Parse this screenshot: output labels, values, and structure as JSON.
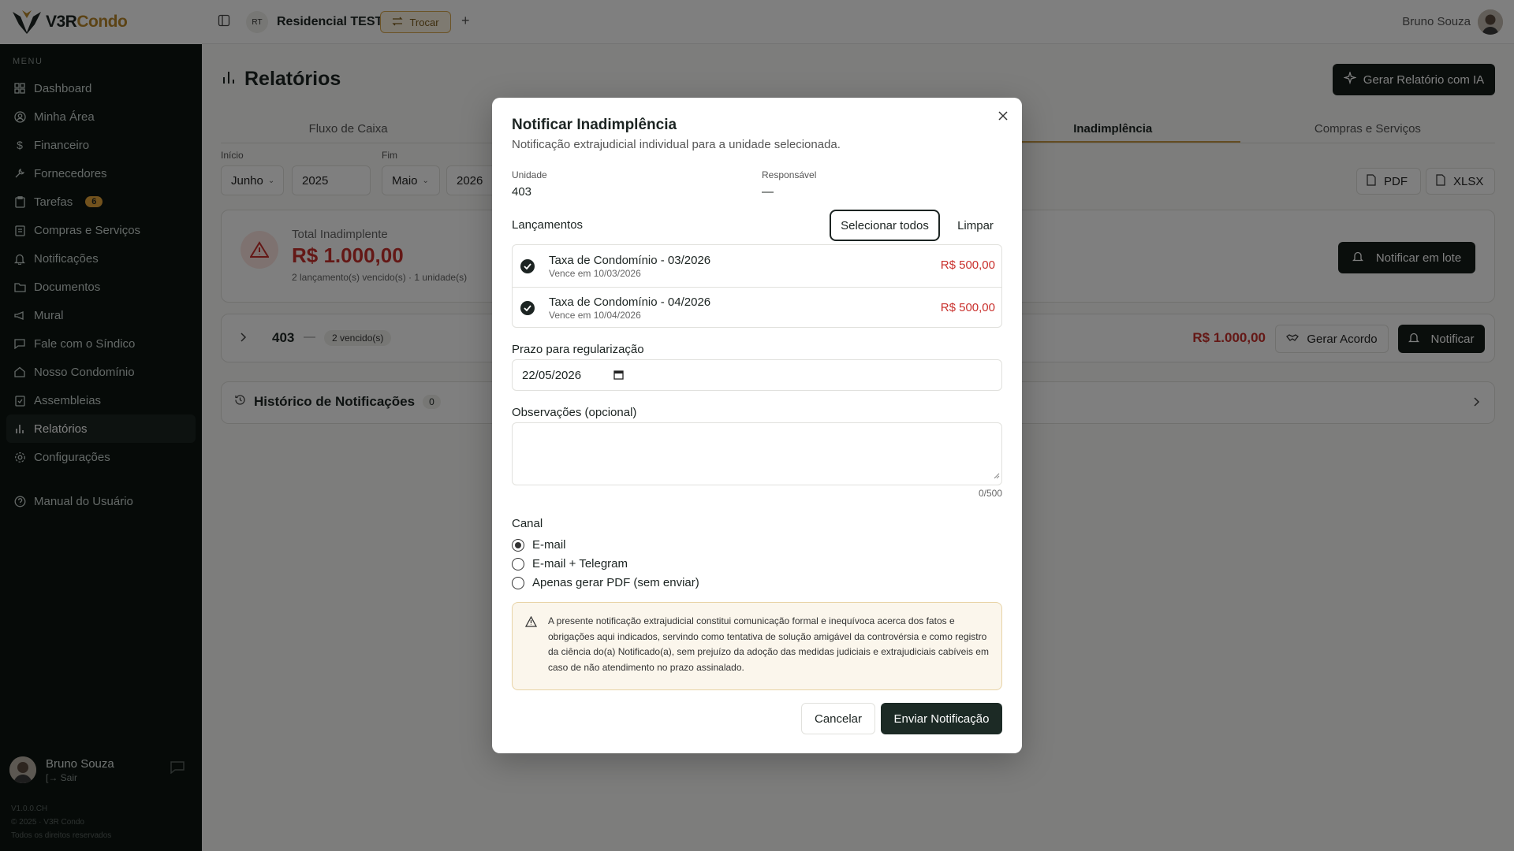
{
  "brand": {
    "logo_part1": "V3R",
    "logo_part2": "Condo",
    "accent_color": "#b8862a"
  },
  "topbar": {
    "condo_initials": "RT",
    "condo_name": "Residencial TESTE",
    "switch_label": "Trocar",
    "user_name": "Bruno Souza"
  },
  "sidebar": {
    "menu_label": "MENU",
    "items": [
      {
        "label": "Dashboard",
        "icon": "grid-icon"
      },
      {
        "label": "Minha Área",
        "icon": "user-circle-icon"
      },
      {
        "label": "Financeiro",
        "icon": "dollar-icon"
      },
      {
        "label": "Fornecedores",
        "icon": "wrench-icon"
      },
      {
        "label": "Tarefas",
        "icon": "clipboard-icon",
        "badge": "6"
      },
      {
        "label": "Compras e Serviços",
        "icon": "clipboard-list-icon"
      },
      {
        "label": "Notificações",
        "icon": "bell-icon"
      },
      {
        "label": "Documentos",
        "icon": "folder-icon"
      },
      {
        "label": "Mural",
        "icon": "megaphone-icon"
      },
      {
        "label": "Fale com o Síndico",
        "icon": "message-icon"
      },
      {
        "label": "Nosso Condomínio",
        "icon": "home-icon"
      },
      {
        "label": "Assembleias",
        "icon": "clipboard-check-icon"
      },
      {
        "label": "Relatórios",
        "icon": "bar-chart-icon",
        "active": true
      },
      {
        "label": "Configurações",
        "icon": "gear-icon"
      }
    ],
    "manual_label": "Manual do Usuário",
    "user_name": "Bruno Souza",
    "user_sub": "[→ Sair",
    "version_line1": "V1.0.0.CH",
    "version_line2": "© 2025 · V3R Condo",
    "version_line3": "Todos os direitos reservados"
  },
  "main": {
    "title": "Relatórios",
    "ia_button": "Gerar Relatório com IA",
    "tabs": [
      {
        "label": "Fluxo de Caixa"
      },
      {
        "label": ""
      },
      {
        "label": ""
      },
      {
        "label": "Inadimplência",
        "active": true
      },
      {
        "label": "Compras e Serviços"
      }
    ],
    "filters": {
      "start_label": "Início",
      "start_month": "Junho",
      "start_year": "2025",
      "end_label": "Fim",
      "end_month": "Maio",
      "end_year": "2026"
    },
    "export": {
      "pdf": "PDF",
      "xlsx": "XLSX"
    },
    "summary": {
      "label": "Total Inadimplente",
      "value": "R$ 1.000,00",
      "sub": "2 lançamento(s) vencido(s) · 1 unidade(s)",
      "batch_button": "Notificar em lote"
    },
    "unit_row": {
      "unit": "403",
      "dash": "—",
      "badge": "2 vencido(s)",
      "total": "R$ 1.000,00",
      "agreement_button": "Gerar Acordo",
      "notify_button": "Notificar"
    },
    "history": {
      "title": "Histórico de Notificações",
      "count": "0"
    }
  },
  "modal": {
    "title": "Notificar Inadimplência",
    "subtitle": "Notificação extrajudicial individual para a unidade selecionada.",
    "unit_label": "Unidade",
    "unit_value": "403",
    "resp_label": "Responsável",
    "resp_value": "—",
    "entries_title": "Lançamentos",
    "select_all": "Selecionar todos",
    "clear": "Limpar",
    "entries": [
      {
        "name": "Taxa de Condomínio - 03/2026",
        "due": "Vence em 10/03/2026",
        "amount": "R$ 500,00"
      },
      {
        "name": "Taxa de Condomínio - 04/2026",
        "due": "Vence em 10/04/2026",
        "amount": "R$ 500,00"
      }
    ],
    "deadline_label": "Prazo para regularização",
    "deadline_value": "22/05/2026",
    "notes_label": "Observações (opcional)",
    "notes_count": "0/500",
    "channel_label": "Canal",
    "channels": [
      {
        "label": "E-mail",
        "selected": true
      },
      {
        "label": "E-mail + Telegram",
        "selected": false
      },
      {
        "label": "Apenas gerar PDF (sem enviar)",
        "selected": false
      }
    ],
    "legal_text": "A presente notificação extrajudicial constitui comunicação formal e inequívoca acerca dos fatos e obrigações aqui indicados, servindo como tentativa de solução amigável da controvérsia e como registro da ciência do(a) Notificado(a), sem prejuízo da adoção das medidas judiciais e extrajudiciais cabíveis em caso de não atendimento no prazo assinalado.",
    "cancel": "Cancelar",
    "send": "Enviar Notificação"
  }
}
